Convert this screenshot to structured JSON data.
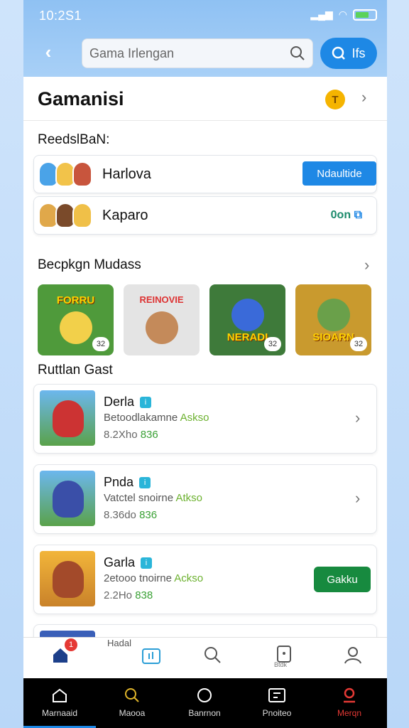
{
  "status": {
    "time": "10:2S1"
  },
  "search": {
    "placeholder": "Gama Irlengan",
    "button_label": "Ifs"
  },
  "page": {
    "title": "Gamanisi",
    "coin": "T"
  },
  "friends": {
    "heading": "ReedslBaN:",
    "items": [
      {
        "name": "Harlova",
        "action": "Ndaultide"
      },
      {
        "name": "Kaparo",
        "action": "0on"
      }
    ]
  },
  "popular": {
    "heading": "Becpkgn Mudass",
    "tiles": [
      {
        "title": "FORRU",
        "badge": "32",
        "bg": "#4f9a3b"
      },
      {
        "title": "REINOVIE",
        "badge": "",
        "bg": "#e4e4e4"
      },
      {
        "title": "NERADI",
        "badge": "32",
        "bg": "#3e7a3a"
      },
      {
        "title": "SIOARN",
        "badge": "32",
        "bg": "#c99a2e"
      }
    ]
  },
  "recent": {
    "heading": "Ruttlan Gast",
    "items": [
      {
        "name": "Derla",
        "tag": "i",
        "desc": "Betoodlakamne",
        "desc_highlight": "Askso",
        "stats": "8.2Xho",
        "stats_highlight": "836",
        "action": ""
      },
      {
        "name": "Pnda",
        "tag": "i",
        "desc": "Vatctel snoirne",
        "desc_highlight": "Atkso",
        "stats": "8.36do",
        "stats_highlight": "836",
        "action": ""
      },
      {
        "name": "Garla",
        "tag": "i",
        "desc": "2etooo tnoirne",
        "desc_highlight": "Ackso",
        "stats": "2.2Ho",
        "stats_highlight": "838",
        "action": "Gakku"
      }
    ],
    "peek_label": "Hadal"
  },
  "light_nav": {
    "notif_count": "1",
    "pad_label": "Btdk"
  },
  "dark_nav": {
    "items": [
      {
        "label": "Marnaaid"
      },
      {
        "label": "Maooa"
      },
      {
        "label": "Banrnon"
      },
      {
        "label": "Pnoiteo"
      },
      {
        "label": "Merqn"
      }
    ]
  },
  "colors": {
    "accent": "#1e88e5",
    "green": "#178a3f",
    "nav_active_red": "#e53935"
  }
}
